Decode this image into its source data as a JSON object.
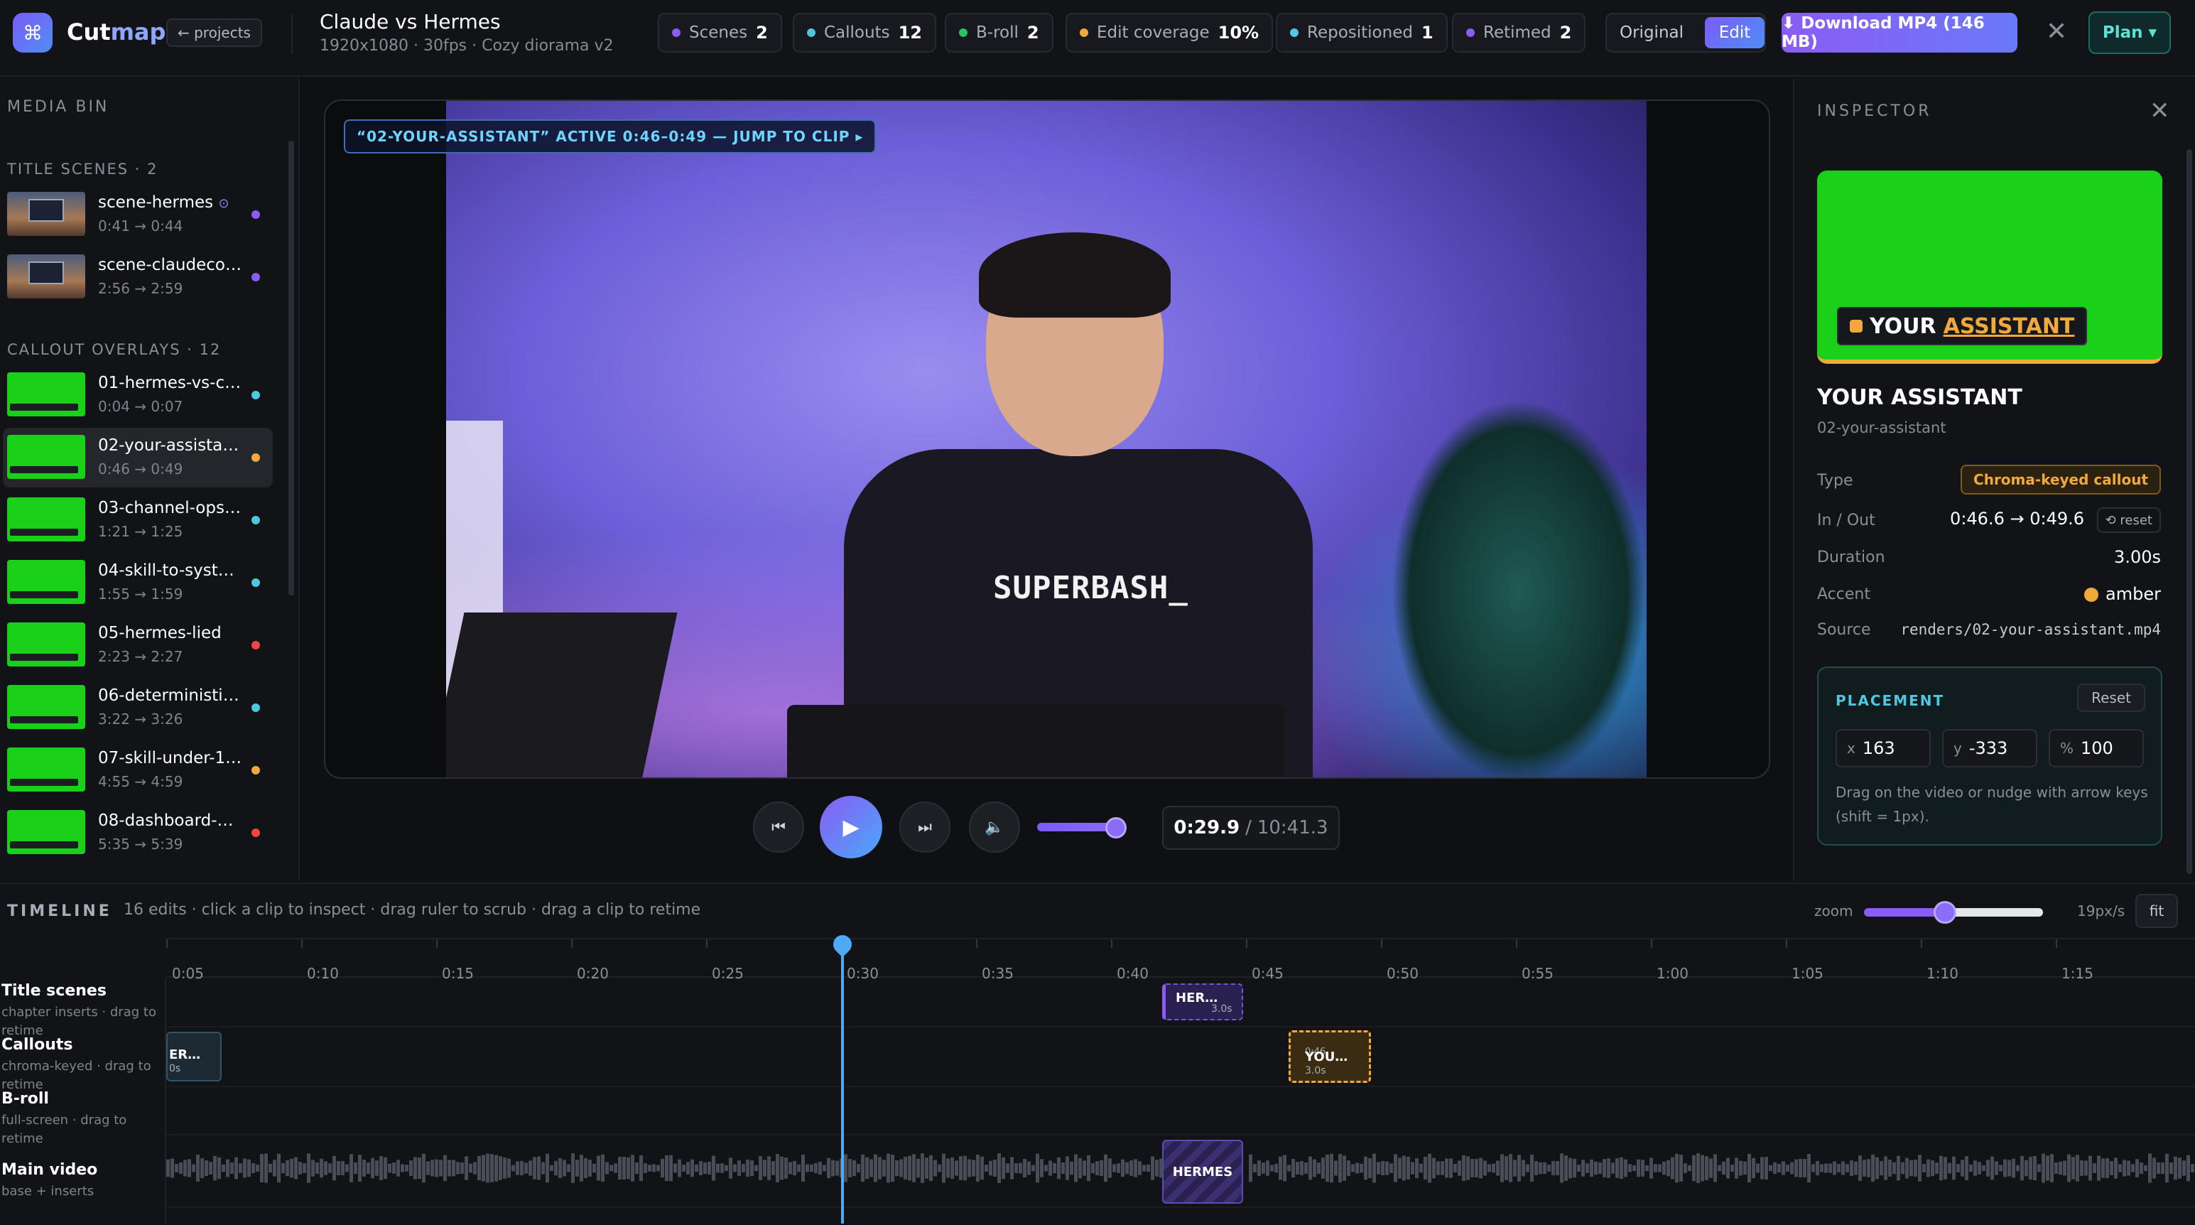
{
  "app": {
    "brand_a": "Cut",
    "brand_b": "map",
    "logo_icon": "⌘",
    "projects_label": "← projects"
  },
  "doc": {
    "title": "Claude vs Hermes",
    "subtitle": "1920x1080 · 30fps · Cozy diorama v2"
  },
  "stats": [
    {
      "label": "Scenes",
      "value": "2",
      "color": "#8b5cf6"
    },
    {
      "label": "Callouts",
      "value": "12",
      "color": "#4fc7e0"
    },
    {
      "label": "B-roll",
      "value": "2",
      "color": "#22c55e"
    },
    {
      "label": "Edit coverage",
      "value": "10%",
      "color": "#f2a93b"
    },
    {
      "label": "Repositioned",
      "value": "1",
      "color": "#4fc7e0"
    },
    {
      "label": "Retimed",
      "value": "2",
      "color": "#8b5cf6"
    }
  ],
  "mode": {
    "original": "Original",
    "edit": "Edit"
  },
  "download_label": "⬇ Download MP4 (146 MB)",
  "plan_label": "Plan ▾",
  "bin": {
    "title": "MEDIA BIN",
    "scenes_header": "TITLE SCENES · 2",
    "scenes": [
      {
        "name": "scene-hermes",
        "time": "0:41 → 0:44",
        "color": "#8b5cf6",
        "mark": "⊙"
      },
      {
        "name": "scene-claudeco…",
        "time": "2:56 → 2:59",
        "color": "#8b5cf6",
        "mark": ""
      }
    ],
    "callouts_header": "CALLOUT OVERLAYS · 12",
    "callouts": [
      {
        "name": "01-hermes-vs-c…",
        "time": "0:04 → 0:07",
        "color": "#4fc7e0"
      },
      {
        "name": "02-your-assista…",
        "time": "0:46 → 0:49",
        "color": "#f2a93b"
      },
      {
        "name": "03-channel-ops…",
        "time": "1:21 → 1:25",
        "color": "#4fc7e0"
      },
      {
        "name": "04-skill-to-syst…",
        "time": "1:55 → 1:59",
        "color": "#4fc7e0"
      },
      {
        "name": "05-hermes-lied",
        "time": "2:23 → 2:27",
        "color": "#ef4444"
      },
      {
        "name": "06-deterministi…",
        "time": "3:22 → 3:26",
        "color": "#4fc7e0"
      },
      {
        "name": "07-skill-under-1…",
        "time": "4:55 → 4:59",
        "color": "#f2a93b"
      },
      {
        "name": "08-dashboard-…",
        "time": "5:35 → 5:39",
        "color": "#ef4444"
      }
    ]
  },
  "viewer": {
    "active_tag": "“02-YOUR-ASSISTANT” ACTIVE 0:46–0:49 — JUMP TO CLIP ▸",
    "shirt_text": "SUPERBASH_"
  },
  "transport": {
    "prev_icon": "⏮",
    "play_icon": "▶",
    "next_icon": "⏭",
    "mute_icon": "🔈",
    "volume": 0.8,
    "current": "0:29.9",
    "sep": "/",
    "total": "10:41.3"
  },
  "inspector": {
    "title": "INSPECTOR",
    "preview_label_a": "YOUR ",
    "preview_label_b": "ASSISTANT",
    "clip_title": "YOUR ASSISTANT",
    "clip_slug": "02-your-assistant",
    "type_label": "Type",
    "type_value": "Chroma-keyed callout",
    "inout_label": "In / Out",
    "inout_value": "0:46.6 → 0:49.6",
    "reset_small": "⟲ reset",
    "duration_label": "Duration",
    "duration_value": "3.00s",
    "accent_label": "Accent",
    "accent_value": "amber",
    "source_label": "Source",
    "source_value": "renders/02-your-assistant.mp4",
    "placement": {
      "title": "PLACEMENT",
      "reset": "Reset",
      "x_label": "x",
      "x": "163",
      "y_label": "y",
      "y": "-333",
      "s_label": "%",
      "s": "100",
      "help": "Drag on the video or nudge with arrow keys (shift = 1px)."
    }
  },
  "timeline": {
    "title": "TIMELINE",
    "hint": "16 edits · click a clip to inspect · drag ruler to scrub · drag a clip to retime",
    "zoom_label": "zoom",
    "zoom_value": "19px/s",
    "zoom_level": 0.47,
    "fit_label": "fit",
    "ticks": [
      "0:05",
      "0:10",
      "0:15",
      "0:20",
      "0:25",
      "0:30",
      "0:35",
      "0:40",
      "0:45",
      "0:50",
      "0:55",
      "1:00",
      "1:05",
      "1:10",
      "1:15"
    ],
    "tracks": [
      {
        "name": "Title scenes",
        "sub": "chapter inserts · drag to retime"
      },
      {
        "name": "Callouts",
        "sub": "chroma-keyed · drag to retime"
      },
      {
        "name": "B-roll",
        "sub": "full-screen · drag to retime"
      },
      {
        "name": "Main video",
        "sub": "base + inserts"
      }
    ],
    "clips": {
      "title_clip": "HER…",
      "title_clip_dur": "3.0s",
      "callout_left": "ER…",
      "callout_left_dur": "0s",
      "callout_active": "YOU…",
      "callout_active_dur": "3.0s",
      "callout_active_start": "0:46",
      "main_insert": "HERMES"
    }
  }
}
